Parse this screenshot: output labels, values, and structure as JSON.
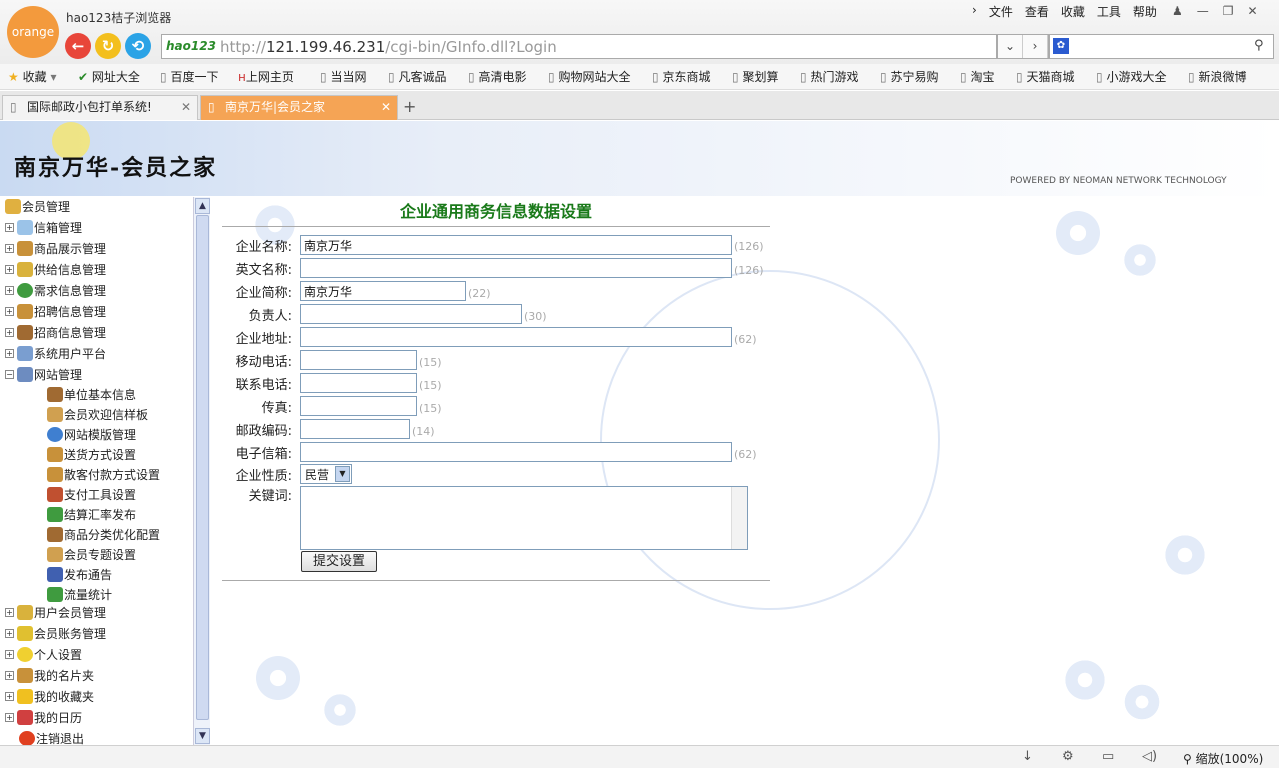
{
  "browser": {
    "logo_text": "orange",
    "title": "hao123桔子浏览器",
    "menu": [
      "文件",
      "查看",
      "收藏",
      "工具",
      "帮助"
    ],
    "addr_logo": "hao123",
    "url_host": "121.199.46.231",
    "url_path": "/cgi-bin/GInfo.dll?Login",
    "url_scheme": "http://",
    "bookmarks": [
      "收藏",
      "网址大全",
      "百度一下",
      "上网主页",
      "当当网",
      "凡客诚品",
      "高清电影",
      "购物网站大全",
      "京东商城",
      "聚划算",
      "热门游戏",
      "苏宁易购",
      "淘宝",
      "天猫商城",
      "小游戏大全",
      "新浪微博"
    ],
    "tabs": [
      {
        "label": "国际邮政小包打单系统!"
      },
      {
        "label": "南京万华|会员之家"
      }
    ],
    "zoom": "缩放(100%)"
  },
  "site": {
    "title": "南京万华-会员之家",
    "powered": "POWERED BY NEOMAN NETWORK TECHNOLOGY"
  },
  "tree": {
    "root": "会员管理",
    "items": [
      {
        "label": "信箱管理",
        "color": "#9bc3e8"
      },
      {
        "label": "商品展示管理",
        "color": "#c8913a"
      },
      {
        "label": "供给信息管理",
        "color": "#d9b23c"
      },
      {
        "label": "需求信息管理",
        "color": "#3f9b3f"
      },
      {
        "label": "招聘信息管理",
        "color": "#c8913a"
      },
      {
        "label": "招商信息管理",
        "color": "#a06a32"
      },
      {
        "label": "系统用户平台",
        "color": "#7a9ed0"
      },
      {
        "label": "网站管理",
        "color": "#6d8cc0"
      }
    ],
    "children": [
      {
        "label": "单位基本信息",
        "color": "#a06a32"
      },
      {
        "label": "会员欢迎信样板",
        "color": "#d0a050"
      },
      {
        "label": "网站模版管理",
        "color": "#3f7fd0"
      },
      {
        "label": "送货方式设置",
        "color": "#c8913a"
      },
      {
        "label": "散客付款方式设置",
        "color": "#c8913a"
      },
      {
        "label": "支付工具设置",
        "color": "#c05030"
      },
      {
        "label": "结算汇率发布",
        "color": "#3f9b3f"
      },
      {
        "label": "商品分类优化配置",
        "color": "#a06a32"
      },
      {
        "label": "会员专题设置",
        "color": "#d0a050"
      },
      {
        "label": "发布通告",
        "color": "#4060b0"
      },
      {
        "label": "流量统计",
        "color": "#3f9b3f"
      }
    ],
    "items2": [
      {
        "label": "用户会员管理",
        "color": "#d9b23c"
      },
      {
        "label": "会员账务管理",
        "color": "#e0c030"
      },
      {
        "label": "个人设置",
        "color": "#f0d030"
      },
      {
        "label": "我的名片夹",
        "color": "#c8913a"
      },
      {
        "label": "我的收藏夹",
        "color": "#f0c020"
      },
      {
        "label": "我的日历",
        "color": "#d04040"
      },
      {
        "label": "注销退出",
        "color": "#e04020"
      }
    ]
  },
  "form": {
    "title": "企业通用商务信息数据设置",
    "fields": [
      {
        "label": "企业名称:",
        "value": "南京万华",
        "hint": "(126)"
      },
      {
        "label": "英文名称:",
        "value": "",
        "hint": "(126)"
      },
      {
        "label": "企业简称:",
        "value": "南京万华",
        "hint": "(22)"
      },
      {
        "label": "负责人:",
        "value": "",
        "hint": "(30)"
      },
      {
        "label": "企业地址:",
        "value": "",
        "hint": "(62)"
      },
      {
        "label": "移动电话:",
        "value": "",
        "hint": "(15)"
      },
      {
        "label": "联系电话:",
        "value": "",
        "hint": "(15)"
      },
      {
        "label": "传真:",
        "value": "",
        "hint": "(15)"
      },
      {
        "label": "邮政编码:",
        "value": "",
        "hint": "(14)"
      },
      {
        "label": "电子信箱:",
        "value": "",
        "hint": "(62)"
      }
    ],
    "nature_label": "企业性质:",
    "nature_value": "民营",
    "keywords_label": "关键词:",
    "submit": "提交设置"
  }
}
